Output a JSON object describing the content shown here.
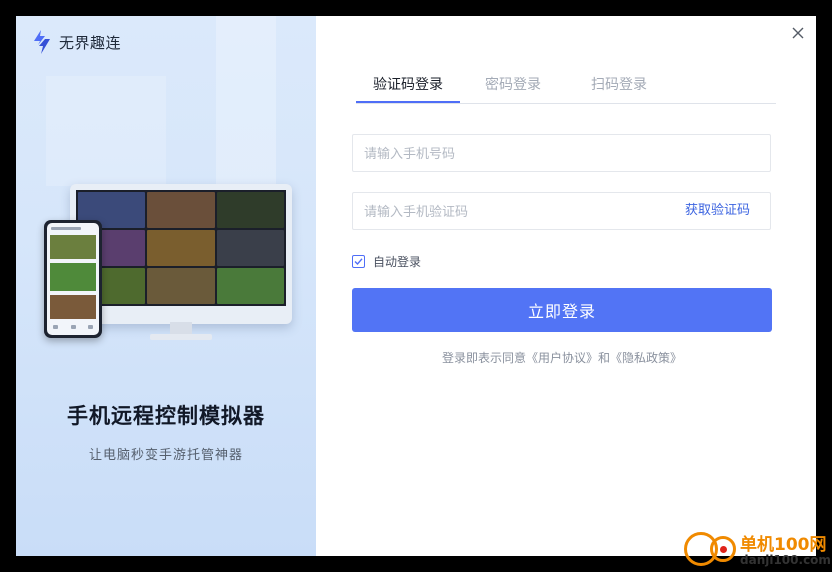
{
  "brand": {
    "name": "无界趣连",
    "accent": "#4f6ef7"
  },
  "promo": {
    "title": "手机远程控制模拟器",
    "subtitle": "让电脑秒变手游托管神器",
    "tile_colors": [
      "#3b4a7a",
      "#6a4f3a",
      "#2f3c2a",
      "#5a3e6e",
      "#7a5e2e",
      "#3a3f4a",
      "#4e6a2e",
      "#6a5a3a",
      "#4a7a3a"
    ]
  },
  "tabs": [
    {
      "label": "验证码登录",
      "active": true
    },
    {
      "label": "密码登录",
      "active": false
    },
    {
      "label": "扫码登录",
      "active": false
    }
  ],
  "form": {
    "phone_placeholder": "请输入手机号码",
    "phone_value": "",
    "code_placeholder": "请输入手机验证码",
    "code_value": "",
    "get_code_label": "获取验证码",
    "auto_login_label": "自动登录",
    "auto_login_checked": true,
    "login_button_label": "立即登录",
    "login_button_color": "#5274f5"
  },
  "agreement": {
    "prefix": "登录即表示同意",
    "user_agreement": "《用户协议》",
    "and": "和",
    "privacy_policy": "《隐私政策》"
  },
  "window": {
    "close_icon": "close-icon"
  },
  "watermark": {
    "line1": "单机100网",
    "line2": "danji100.com"
  }
}
